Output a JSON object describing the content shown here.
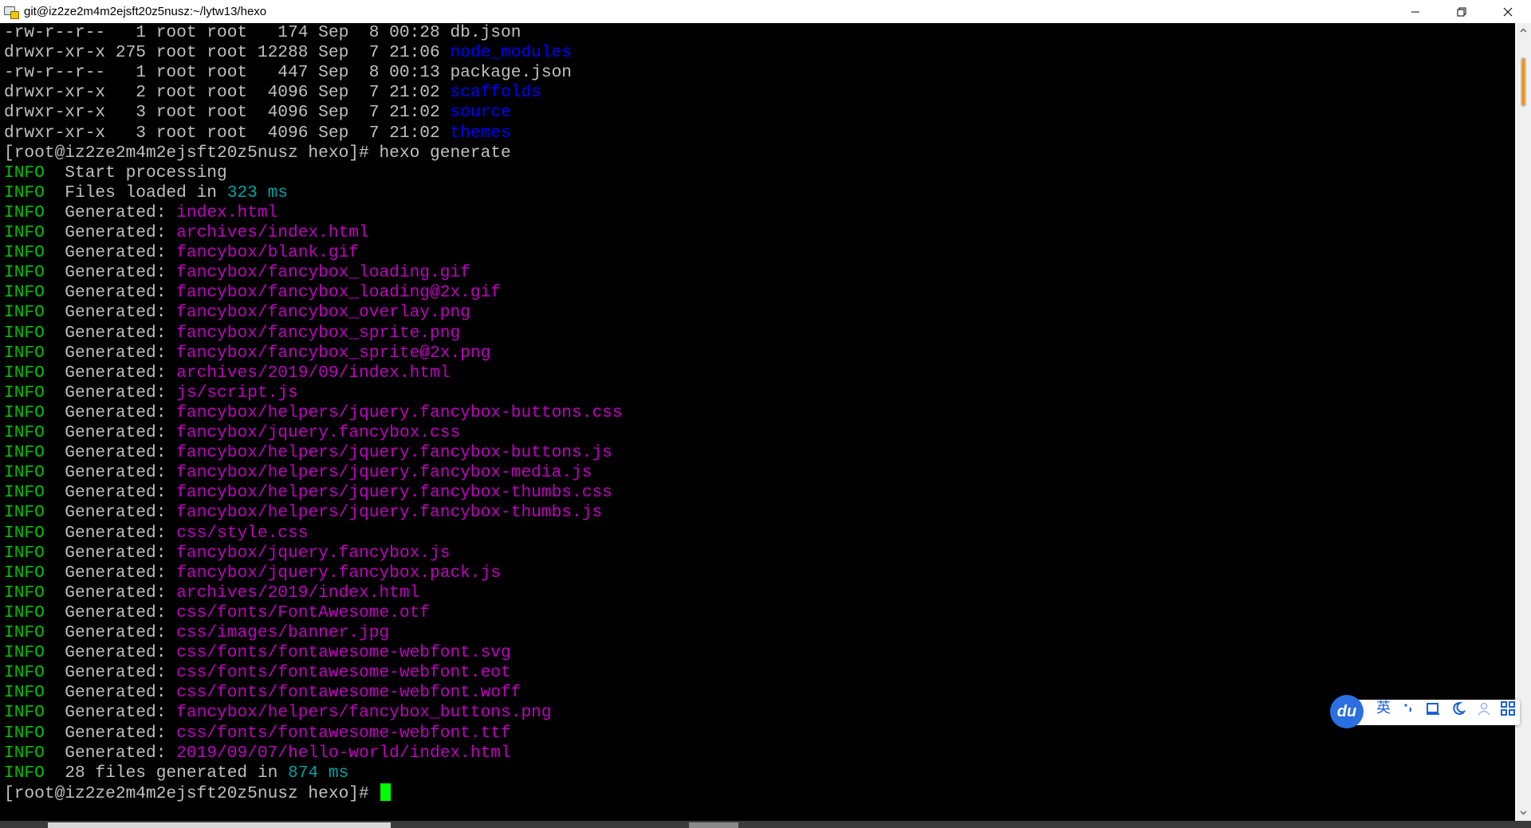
{
  "window": {
    "title": "git@iz2ze2m4m2ejsft20z5nusz:~/lytw13/hexo",
    "icon": "putty-icon",
    "controls": [
      "minimize-icon",
      "restore-icon",
      "close-icon"
    ]
  },
  "colors": {
    "background": "#000000",
    "text": "#c0c0c0",
    "directory": "#0000ff",
    "info": "#00c000",
    "path": "#c000c0",
    "number": "#00a0a0",
    "cursor": "#00ff00",
    "scroll_thumb": "#ff8c00",
    "ime_accent": "#2b6fe0"
  },
  "terminal": {
    "lines": [
      [
        {
          "t": "-rw-r--r--   1 root root   174 Sep  8 00:28 db.json",
          "c": "white"
        }
      ],
      [
        {
          "t": "drwxr-xr-x 275 root root 12288 Sep  7 21:06 ",
          "c": "white"
        },
        {
          "t": "node_modules",
          "c": "blue"
        }
      ],
      [
        {
          "t": "-rw-r--r--   1 root root   447 Sep  8 00:13 package.json",
          "c": "white"
        }
      ],
      [
        {
          "t": "drwxr-xr-x   2 root root  4096 Sep  7 21:02 ",
          "c": "white"
        },
        {
          "t": "scaffolds",
          "c": "blue"
        }
      ],
      [
        {
          "t": "drwxr-xr-x   3 root root  4096 Sep  7 21:02 ",
          "c": "white"
        },
        {
          "t": "source",
          "c": "blue"
        }
      ],
      [
        {
          "t": "drwxr-xr-x   3 root root  4096 Sep  7 21:02 ",
          "c": "white"
        },
        {
          "t": "themes",
          "c": "blue"
        }
      ],
      [
        {
          "t": "[root@iz2ze2m4m2ejsft20z5nusz hexo]# hexo generate",
          "c": "white"
        }
      ],
      [
        {
          "t": "INFO",
          "c": "green"
        },
        {
          "t": "  Start processing",
          "c": "white"
        }
      ],
      [
        {
          "t": "INFO",
          "c": "green"
        },
        {
          "t": "  Files loaded in ",
          "c": "white"
        },
        {
          "t": "323 ms",
          "c": "cyan"
        }
      ],
      [
        {
          "t": "INFO",
          "c": "green"
        },
        {
          "t": "  Generated: ",
          "c": "white"
        },
        {
          "t": "index.html",
          "c": "magenta"
        }
      ],
      [
        {
          "t": "INFO",
          "c": "green"
        },
        {
          "t": "  Generated: ",
          "c": "white"
        },
        {
          "t": "archives/index.html",
          "c": "magenta"
        }
      ],
      [
        {
          "t": "INFO",
          "c": "green"
        },
        {
          "t": "  Generated: ",
          "c": "white"
        },
        {
          "t": "fancybox/blank.gif",
          "c": "magenta"
        }
      ],
      [
        {
          "t": "INFO",
          "c": "green"
        },
        {
          "t": "  Generated: ",
          "c": "white"
        },
        {
          "t": "fancybox/fancybox_loading.gif",
          "c": "magenta"
        }
      ],
      [
        {
          "t": "INFO",
          "c": "green"
        },
        {
          "t": "  Generated: ",
          "c": "white"
        },
        {
          "t": "fancybox/fancybox_loading@2x.gif",
          "c": "magenta"
        }
      ],
      [
        {
          "t": "INFO",
          "c": "green"
        },
        {
          "t": "  Generated: ",
          "c": "white"
        },
        {
          "t": "fancybox/fancybox_overlay.png",
          "c": "magenta"
        }
      ],
      [
        {
          "t": "INFO",
          "c": "green"
        },
        {
          "t": "  Generated: ",
          "c": "white"
        },
        {
          "t": "fancybox/fancybox_sprite.png",
          "c": "magenta"
        }
      ],
      [
        {
          "t": "INFO",
          "c": "green"
        },
        {
          "t": "  Generated: ",
          "c": "white"
        },
        {
          "t": "fancybox/fancybox_sprite@2x.png",
          "c": "magenta"
        }
      ],
      [
        {
          "t": "INFO",
          "c": "green"
        },
        {
          "t": "  Generated: ",
          "c": "white"
        },
        {
          "t": "archives/2019/09/index.html",
          "c": "magenta"
        }
      ],
      [
        {
          "t": "INFO",
          "c": "green"
        },
        {
          "t": "  Generated: ",
          "c": "white"
        },
        {
          "t": "js/script.js",
          "c": "magenta"
        }
      ],
      [
        {
          "t": "INFO",
          "c": "green"
        },
        {
          "t": "  Generated: ",
          "c": "white"
        },
        {
          "t": "fancybox/helpers/jquery.fancybox-buttons.css",
          "c": "magenta"
        }
      ],
      [
        {
          "t": "INFO",
          "c": "green"
        },
        {
          "t": "  Generated: ",
          "c": "white"
        },
        {
          "t": "fancybox/jquery.fancybox.css",
          "c": "magenta"
        }
      ],
      [
        {
          "t": "INFO",
          "c": "green"
        },
        {
          "t": "  Generated: ",
          "c": "white"
        },
        {
          "t": "fancybox/helpers/jquery.fancybox-buttons.js",
          "c": "magenta"
        }
      ],
      [
        {
          "t": "INFO",
          "c": "green"
        },
        {
          "t": "  Generated: ",
          "c": "white"
        },
        {
          "t": "fancybox/helpers/jquery.fancybox-media.js",
          "c": "magenta"
        }
      ],
      [
        {
          "t": "INFO",
          "c": "green"
        },
        {
          "t": "  Generated: ",
          "c": "white"
        },
        {
          "t": "fancybox/helpers/jquery.fancybox-thumbs.css",
          "c": "magenta"
        }
      ],
      [
        {
          "t": "INFO",
          "c": "green"
        },
        {
          "t": "  Generated: ",
          "c": "white"
        },
        {
          "t": "fancybox/helpers/jquery.fancybox-thumbs.js",
          "c": "magenta"
        }
      ],
      [
        {
          "t": "INFO",
          "c": "green"
        },
        {
          "t": "  Generated: ",
          "c": "white"
        },
        {
          "t": "css/style.css",
          "c": "magenta"
        }
      ],
      [
        {
          "t": "INFO",
          "c": "green"
        },
        {
          "t": "  Generated: ",
          "c": "white"
        },
        {
          "t": "fancybox/jquery.fancybox.js",
          "c": "magenta"
        }
      ],
      [
        {
          "t": "INFO",
          "c": "green"
        },
        {
          "t": "  Generated: ",
          "c": "white"
        },
        {
          "t": "fancybox/jquery.fancybox.pack.js",
          "c": "magenta"
        }
      ],
      [
        {
          "t": "INFO",
          "c": "green"
        },
        {
          "t": "  Generated: ",
          "c": "white"
        },
        {
          "t": "archives/2019/index.html",
          "c": "magenta"
        }
      ],
      [
        {
          "t": "INFO",
          "c": "green"
        },
        {
          "t": "  Generated: ",
          "c": "white"
        },
        {
          "t": "css/fonts/FontAwesome.otf",
          "c": "magenta"
        }
      ],
      [
        {
          "t": "INFO",
          "c": "green"
        },
        {
          "t": "  Generated: ",
          "c": "white"
        },
        {
          "t": "css/images/banner.jpg",
          "c": "magenta"
        }
      ],
      [
        {
          "t": "INFO",
          "c": "green"
        },
        {
          "t": "  Generated: ",
          "c": "white"
        },
        {
          "t": "css/fonts/fontawesome-webfont.svg",
          "c": "magenta"
        }
      ],
      [
        {
          "t": "INFO",
          "c": "green"
        },
        {
          "t": "  Generated: ",
          "c": "white"
        },
        {
          "t": "css/fonts/fontawesome-webfont.eot",
          "c": "magenta"
        }
      ],
      [
        {
          "t": "INFO",
          "c": "green"
        },
        {
          "t": "  Generated: ",
          "c": "white"
        },
        {
          "t": "css/fonts/fontawesome-webfont.woff",
          "c": "magenta"
        }
      ],
      [
        {
          "t": "INFO",
          "c": "green"
        },
        {
          "t": "  Generated: ",
          "c": "white"
        },
        {
          "t": "fancybox/helpers/fancybox_buttons.png",
          "c": "magenta"
        }
      ],
      [
        {
          "t": "INFO",
          "c": "green"
        },
        {
          "t": "  Generated: ",
          "c": "white"
        },
        {
          "t": "css/fonts/fontawesome-webfont.ttf",
          "c": "magenta"
        }
      ],
      [
        {
          "t": "INFO",
          "c": "green"
        },
        {
          "t": "  Generated: ",
          "c": "white"
        },
        {
          "t": "2019/09/07/hello-world/index.html",
          "c": "magenta"
        }
      ],
      [
        {
          "t": "INFO",
          "c": "green"
        },
        {
          "t": "  28 files generated in ",
          "c": "white"
        },
        {
          "t": "874 ms",
          "c": "cyan"
        }
      ],
      [
        {
          "t": "[root@iz2ze2m4m2ejsft20z5nusz hexo]# ",
          "c": "white"
        }
      ]
    ]
  },
  "ime_toolbar": {
    "logo": "du",
    "lang": "英",
    "items": [
      "punctuation-icon",
      "keyboard-icon",
      "moon-skin-icon",
      "user-icon",
      "grid-menu-icon"
    ]
  }
}
